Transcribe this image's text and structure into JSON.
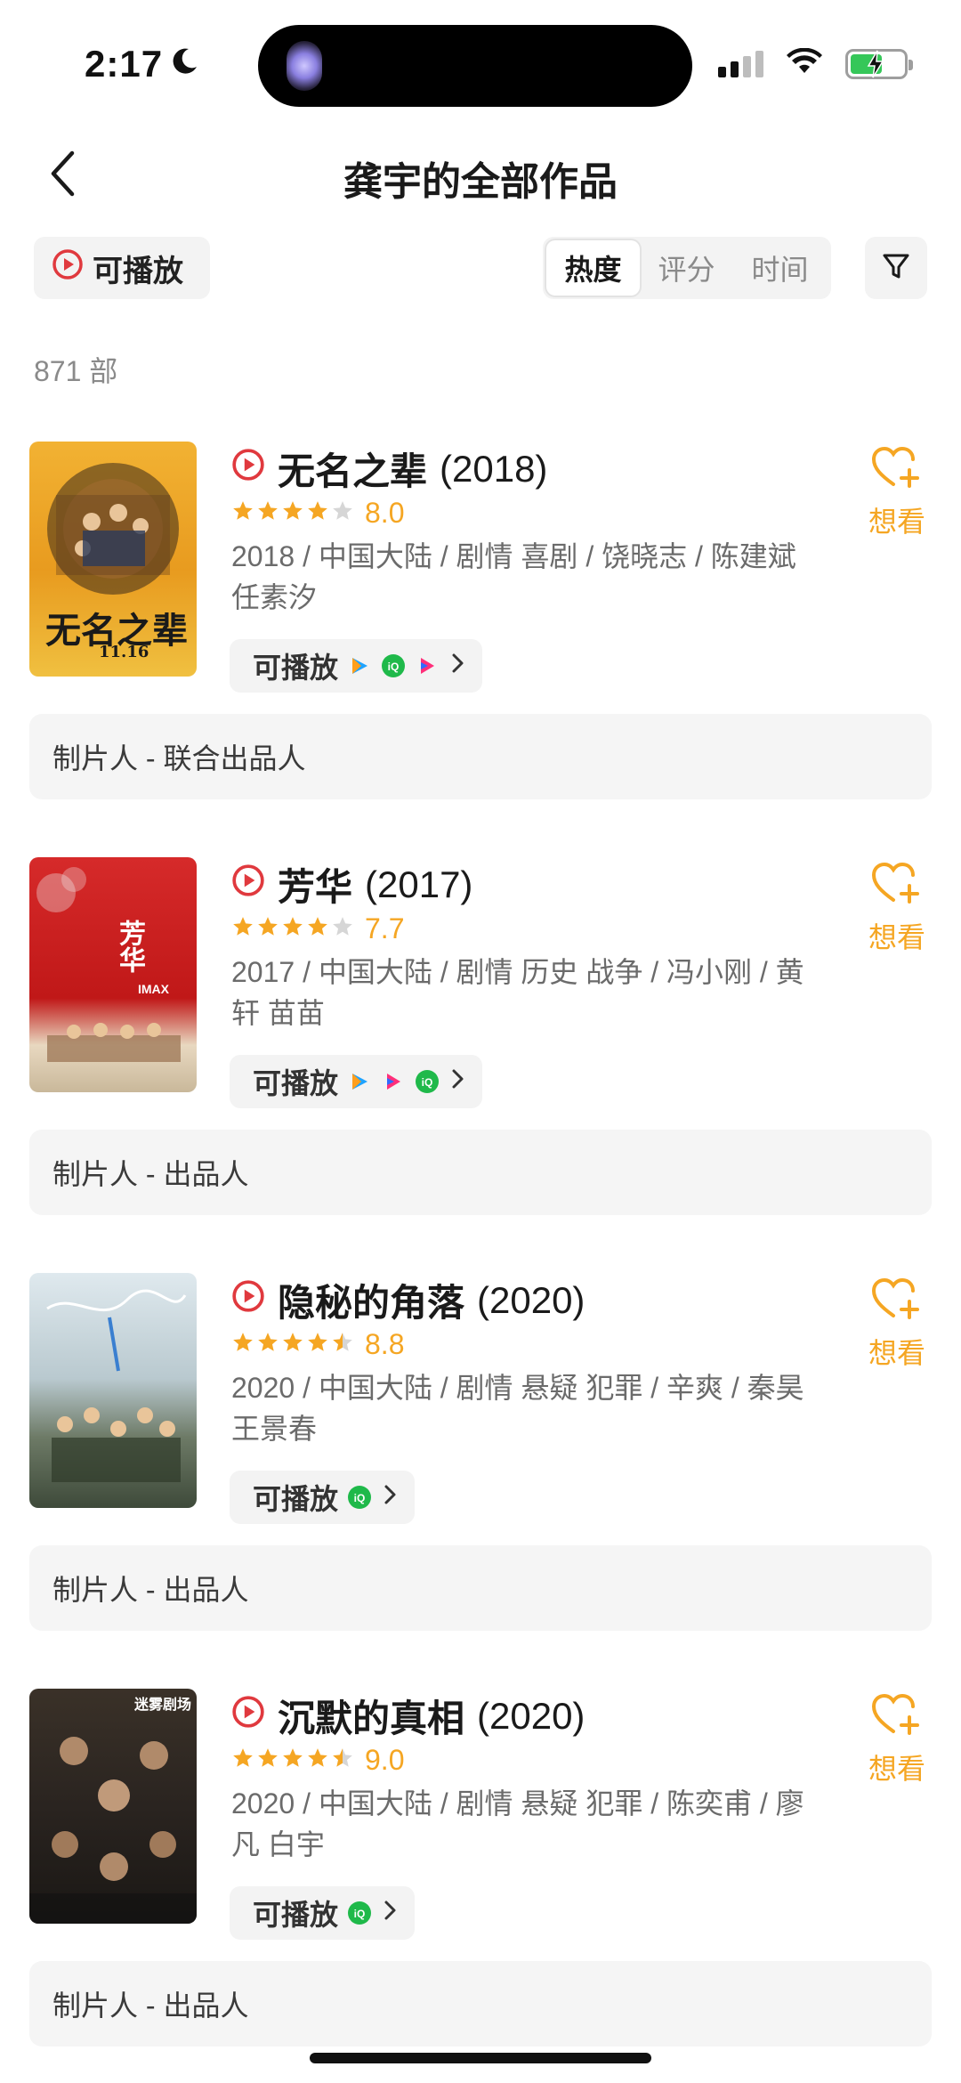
{
  "status": {
    "time": "2:17"
  },
  "header": {
    "title": "龚宇的全部作品"
  },
  "filters": {
    "playable_label": "可播放",
    "sort_tabs": [
      {
        "label": "热度",
        "active": true
      },
      {
        "label": "评分",
        "active": false
      },
      {
        "label": "时间",
        "active": false
      }
    ]
  },
  "count_text": "871 部",
  "colors": {
    "accent": "#f5a623",
    "play_red": "#e0393e",
    "iqiyi_green": "#1fb94a"
  },
  "movies": [
    {
      "title": "无名之辈",
      "year": "(2018)",
      "stars": 4,
      "score": "8.0",
      "meta": "2018 / 中国大陆 / 剧情 喜剧 / 饶晓志 / 陈建斌 任素汐",
      "play_label": "可播放",
      "platforms": [
        "tencent-video-icon",
        "iqiyi-icon",
        "youku-icon"
      ],
      "want_label": "想看",
      "role": "制片人 - 联合出品人",
      "poster_text": "无名之辈",
      "poster_date": "11.16"
    },
    {
      "title": "芳华",
      "year": "(2017)",
      "stars": 4,
      "score": "7.7",
      "meta": "2017 / 中国大陆 / 剧情 历史 战争 / 冯小刚 / 黄轩 苗苗",
      "play_label": "可播放",
      "platforms": [
        "tencent-video-icon",
        "youku-icon",
        "iqiyi-icon"
      ],
      "want_label": "想看",
      "role": "制片人 - 出品人",
      "poster_text": "芳华",
      "poster_date": "IMAX"
    },
    {
      "title": "隐秘的角落",
      "year": "(2020)",
      "stars": 4.5,
      "score": "8.8",
      "meta": "2020 / 中国大陆 / 剧情 悬疑 犯罪 / 辛爽 / 秦昊 王景春",
      "play_label": "可播放",
      "platforms": [
        "iqiyi-icon"
      ],
      "want_label": "想看",
      "role": "制片人 - 出品人",
      "poster_text": "",
      "poster_date": ""
    },
    {
      "title": "沉默的真相",
      "year": "(2020)",
      "stars": 4.5,
      "score": "9.0",
      "meta": "2020 / 中国大陆 / 剧情 悬疑 犯罪 / 陈奕甫 / 廖凡 白宇",
      "play_label": "可播放",
      "platforms": [
        "iqiyi-icon"
      ],
      "want_label": "想看",
      "role": "制片人 - 出品人",
      "poster_text": "",
      "poster_date": "迷雾剧场"
    }
  ]
}
